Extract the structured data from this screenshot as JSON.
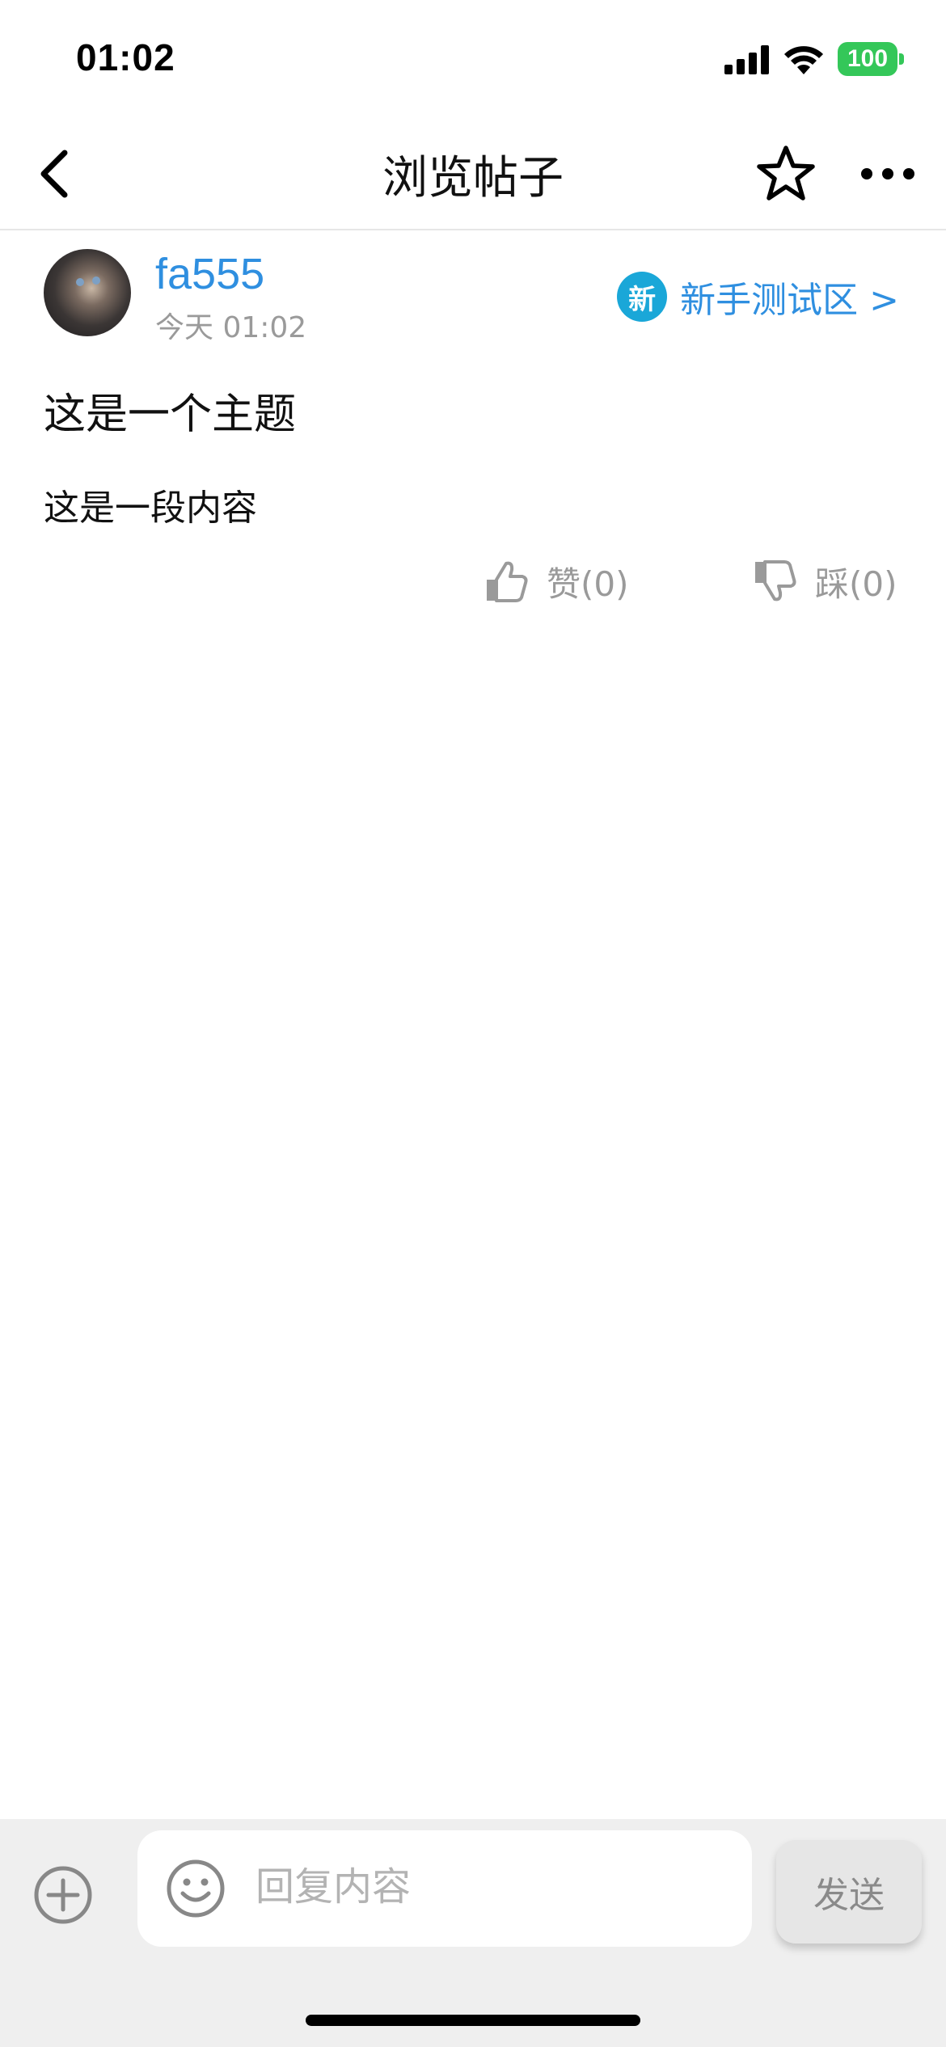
{
  "status_bar": {
    "time": "01:02",
    "battery": "100",
    "battery_color": "#34c759"
  },
  "nav": {
    "title": "浏览帖子",
    "back_icon": "chevron-left-icon",
    "star_icon": "star-outline-icon",
    "more_icon": "more-horizontal-icon"
  },
  "post": {
    "author": "fa555",
    "time": "今天 01:02",
    "forum_badge": "新",
    "forum_name": "新手测试区 >",
    "title": "这是一个主题",
    "content": "这是一段内容",
    "like_label": "赞(0)",
    "dislike_label": "踩(0)"
  },
  "composer": {
    "placeholder": "回复内容",
    "send_label": "发送"
  },
  "colors": {
    "link": "#2f8fe0",
    "badge": "#1aa7d8",
    "muted": "#9a9a9a"
  }
}
